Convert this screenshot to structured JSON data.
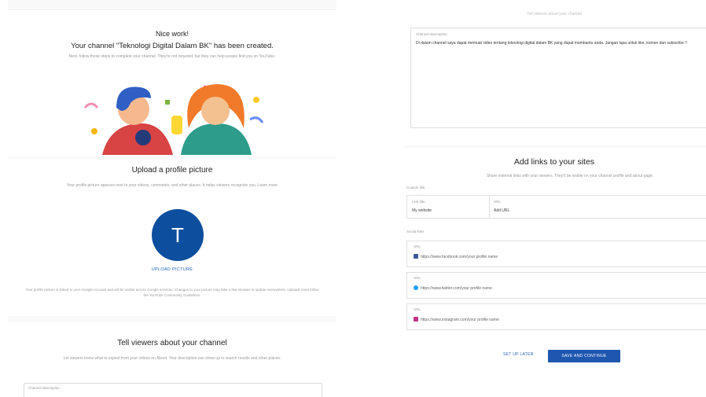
{
  "created": {
    "nice": "Nice work!",
    "channel_line": "Your channel \"Teknologi Digital Dalam BK\" has been created.",
    "subtitle": "Next, follow these steps to complete your channel. They're not required, but they can help people find you on YouTube."
  },
  "profile": {
    "title": "Upload a profile picture",
    "description": "Your profile picture appears next to your videos, comments, and other places. It helps viewers recognize you. Learn more",
    "avatar_letter": "T",
    "upload_button": "UPLOAD PICTURE",
    "fine_print": "Your profile picture is linked to your Google Account and will be visible across Google services. Changes to your picture may take a few minutes to update everywhere. Uploads must follow the YouTube Community Guidelines."
  },
  "tell": {
    "title": "Tell viewers about your channel",
    "description": "Let viewers know what to expect from your videos on About. Your description can show up in search results and other places.",
    "box_label": "Channel description"
  },
  "right_top": {
    "faint": "Tell viewers about your channel"
  },
  "channel_description": {
    "label": "Channel description",
    "text": "Di dalam channel saya dapat memuat video tentang teknologi digital dalam BK yang dapat membantu anda. Jangan lupa untuk like, komen dan subscribe !!"
  },
  "links": {
    "title": "Add links to your sites",
    "subtitle": "Share external links with your viewers. They'll be visible on your channel profile and about page.",
    "custom_head": "Custom link",
    "custom": {
      "title_label": "Link title",
      "title_value": "My website",
      "url_label": "URL",
      "url_value": "Add URL"
    },
    "social_head": "Social links",
    "social": [
      {
        "label": "URL",
        "value": "https://www.facebook.com/your profile name"
      },
      {
        "label": "URL",
        "value": "https://www.twitter.com/your profile name"
      },
      {
        "label": "URL",
        "value": "https://www.instagram.com/your profile name"
      }
    ]
  },
  "actions": {
    "set_later": "SET UP LATER",
    "save": "SAVE AND CONTINUE"
  },
  "icons": {
    "facebook": "facebook-icon",
    "twitter": "twitter-icon",
    "instagram": "instagram-icon"
  },
  "colors": {
    "avatar_bg": "#0e4e9e",
    "primary_button": "#1e56b0",
    "link": "#2a61b0"
  }
}
